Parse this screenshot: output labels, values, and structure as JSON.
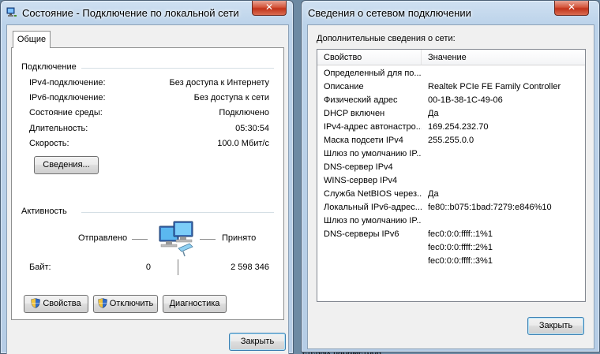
{
  "status_window": {
    "title": "Состояние - Подключение по локальной сети",
    "close_glyph": "✕",
    "tab": "Общие",
    "connection": {
      "header": "Подключение",
      "rows": [
        {
          "label": "IPv4-подключение:",
          "value": "Без доступа к Интернету"
        },
        {
          "label": "IPv6-подключение:",
          "value": "Без доступа к сети"
        },
        {
          "label": "Состояние среды:",
          "value": "Подключено"
        },
        {
          "label": "Длительность:",
          "value": "05:30:54"
        },
        {
          "label": "Скорость:",
          "value": "100.0 Мбит/с"
        }
      ],
      "details_button": "Сведения..."
    },
    "activity": {
      "header": "Активность",
      "sent_label": "Отправлено",
      "received_label": "Принято",
      "bytes_label": "Байт:",
      "bytes_sent": "0",
      "bytes_received": "2 598 346"
    },
    "buttons": {
      "properties": "Свойства",
      "disable": "Отключить",
      "diagnose": "Диагностика",
      "close": "Закрыть"
    }
  },
  "details_window": {
    "title": "Сведения о сетевом подключении",
    "close_glyph": "✕",
    "caption": "Дополнительные сведения о сети:",
    "columns": {
      "property": "Свойство",
      "value": "Значение"
    },
    "rows": [
      {
        "property": "Определенный для по...",
        "value": ""
      },
      {
        "property": "Описание",
        "value": "Realtek PCIe FE Family Controller"
      },
      {
        "property": "Физический адрес",
        "value": "00-1B-38-1C-49-06"
      },
      {
        "property": "DHCP включен",
        "value": "Да"
      },
      {
        "property": "IPv4-адрес автонастро...",
        "value": "169.254.232.70"
      },
      {
        "property": "Маска подсети IPv4",
        "value": "255.255.0.0"
      },
      {
        "property": "Шлюз по умолчанию IP...",
        "value": ""
      },
      {
        "property": "DNS-сервер IPv4",
        "value": ""
      },
      {
        "property": "WINS-сервер IPv4",
        "value": ""
      },
      {
        "property": "Служба NetBIOS через...",
        "value": "Да"
      },
      {
        "property": "Локальный IPv6-адрес...",
        "value": "fe80::b075:1bad:7279:e846%10"
      },
      {
        "property": "Шлюз по умолчанию IP...",
        "value": ""
      },
      {
        "property": "DNS-серверы IPv6",
        "value": "fec0:0:0:ffff::1%1"
      },
      {
        "property": "",
        "value": "fec0:0:0:ffff::2%1"
      },
      {
        "property": "",
        "value": "fec0:0:0:ffff::3%1"
      }
    ],
    "close_button": "Закрыть"
  },
  "background_text": "етевых параметров"
}
